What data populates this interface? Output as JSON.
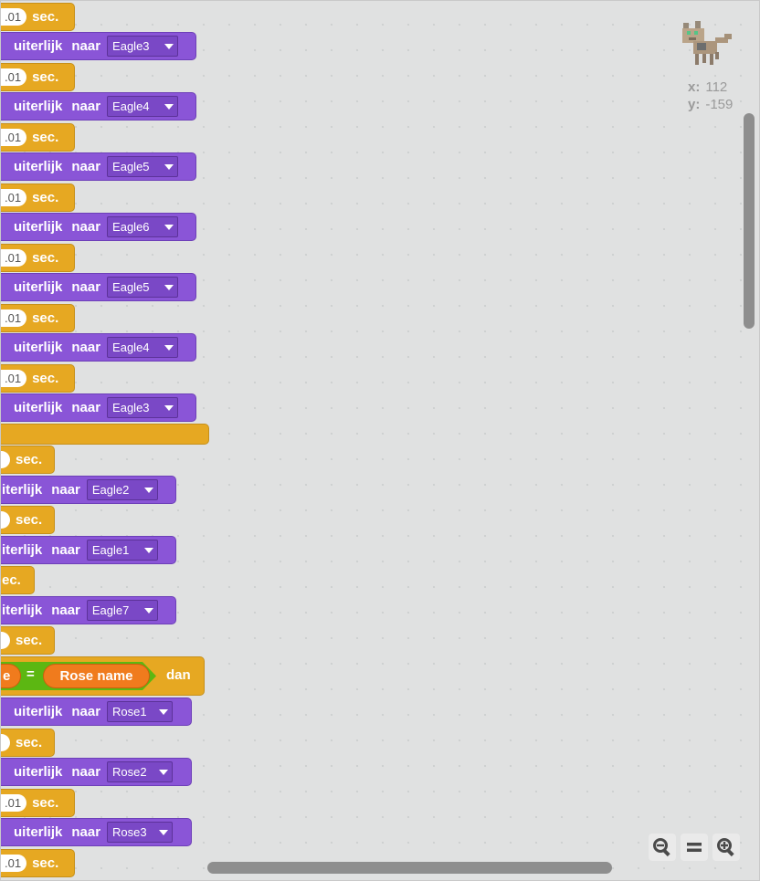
{
  "blocks": {
    "wait_suffix": "sec.",
    "wait_value": ".01",
    "looks_words": [
      "uiterlijk",
      "naar"
    ],
    "looks_words_cut": [
      "iterlijk",
      "naar"
    ],
    "costumes": [
      "Eagle3",
      "Eagle4",
      "Eagle5",
      "Eagle6",
      "Eagle5",
      "Eagle4",
      "Eagle3",
      "Eagle2",
      "Eagle1",
      "Eagle7",
      "Rose1",
      "Rose2",
      "Rose3"
    ],
    "wait_cut_text": "ec."
  },
  "if_block": {
    "left_cut": "e",
    "operator": "=",
    "right_value": "Rose name",
    "suffix": "dan"
  },
  "sprite_info": {
    "x_label": "x:",
    "x_value": "112",
    "y_label": "y:",
    "y_value": "-159"
  },
  "zoom": {
    "zoom_out_icon": "zoom-out-icon",
    "reset_icon": "zoom-reset-icon",
    "zoom_in_icon": "zoom-in-icon"
  }
}
